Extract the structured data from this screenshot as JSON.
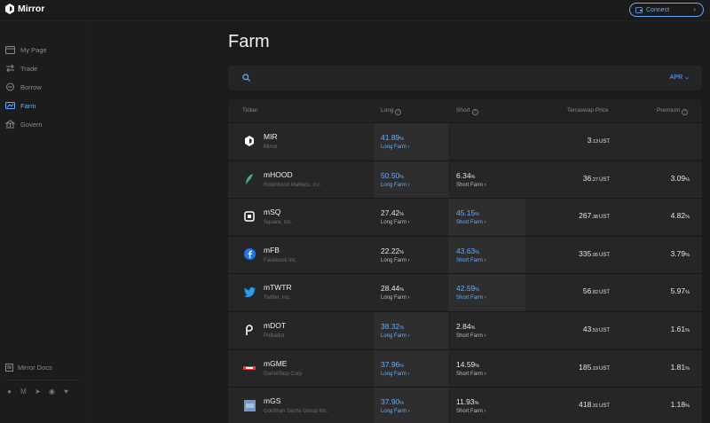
{
  "app": {
    "name": "Mirror"
  },
  "header": {
    "connect_label": "Connect"
  },
  "sidebar": {
    "items": [
      {
        "label": "My Page",
        "icon": "wallet-icon"
      },
      {
        "label": "Trade",
        "icon": "trade-arrows-icon"
      },
      {
        "label": "Borrow",
        "icon": "borrow-icon"
      },
      {
        "label": "Farm",
        "icon": "farm-icon",
        "active": true
      },
      {
        "label": "Govern",
        "icon": "govern-icon"
      }
    ],
    "docs_label": "Mirror Docs",
    "social_icons": [
      "github-icon",
      "medium-icon",
      "telegram-icon",
      "discord-icon",
      "twitter-icon"
    ]
  },
  "page": {
    "title": "Farm"
  },
  "search": {
    "placeholder": "",
    "sort_label": "APR"
  },
  "table": {
    "headers": {
      "ticker": "Ticker",
      "long": "Long",
      "short": "Short",
      "price": "Terraswap Price",
      "premium": "Premium"
    },
    "rows": [
      {
        "symbol": "MIR",
        "name": "Mirror",
        "icon": "mirror-logo-icon",
        "long": "41.89",
        "long_link": "Long Farm",
        "short": "",
        "short_link": "",
        "price_int": "3",
        "price_dec": ".13",
        "price_unit": "UST",
        "premium": "",
        "highlight": "long"
      },
      {
        "symbol": "mHOOD",
        "name": "Robinhood Markets, Inc.",
        "icon": "feather-icon",
        "long": "50.50",
        "long_link": "Long Farm",
        "short": "6.34",
        "short_link": "Short Farm",
        "price_int": "36",
        "price_dec": ".27",
        "price_unit": "UST",
        "premium": "3.09",
        "highlight": "long"
      },
      {
        "symbol": "mSQ",
        "name": "Square, Inc.",
        "icon": "square-logo-icon",
        "long": "27.42",
        "long_link": "Long Farm",
        "short": "45.15",
        "short_link": "Short Farm",
        "price_int": "267",
        "price_dec": ".38",
        "price_unit": "UST",
        "premium": "4.82",
        "highlight": "short"
      },
      {
        "symbol": "mFB",
        "name": "Facebook Inc.",
        "icon": "facebook-icon",
        "long": "22.22",
        "long_link": "Long Farm",
        "short": "43.63",
        "short_link": "Short Farm",
        "price_int": "335",
        "price_dec": ".95",
        "price_unit": "UST",
        "premium": "3.79",
        "highlight": "short"
      },
      {
        "symbol": "mTWTR",
        "name": "Twitter, Inc.",
        "icon": "twitter-bird-icon",
        "long": "28.44",
        "long_link": "Long Farm",
        "short": "42.59",
        "short_link": "Short Farm",
        "price_int": "56",
        "price_dec": ".82",
        "price_unit": "UST",
        "premium": "5.97",
        "highlight": "short"
      },
      {
        "symbol": "mDOT",
        "name": "Polkadot",
        "icon": "polkadot-icon",
        "long": "38.32",
        "long_link": "Long Farm",
        "short": "2.84",
        "short_link": "Short Farm",
        "price_int": "43",
        "price_dec": ".53",
        "price_unit": "UST",
        "premium": "1.61",
        "highlight": "long"
      },
      {
        "symbol": "mGME",
        "name": "GameStop Corp",
        "icon": "gamestop-icon",
        "long": "37.96",
        "long_link": "Long Farm",
        "short": "14.59",
        "short_link": "Short Farm",
        "price_int": "185",
        "price_dec": ".19",
        "price_unit": "UST",
        "premium": "1.81",
        "highlight": "long"
      },
      {
        "symbol": "mGS",
        "name": "Goldman Sachs Group Inc.",
        "icon": "goldman-sachs-icon",
        "long": "37.90",
        "long_link": "Long Farm",
        "short": "11.93",
        "short_link": "Short Farm",
        "price_int": "418",
        "price_dec": ".31",
        "price_unit": "UST",
        "premium": "1.18",
        "highlight": "long"
      }
    ]
  },
  "colors": {
    "accent": "#66adff",
    "background": "#1a1a1a",
    "row": "#262626",
    "row_highlight": "#2e2e2e"
  }
}
